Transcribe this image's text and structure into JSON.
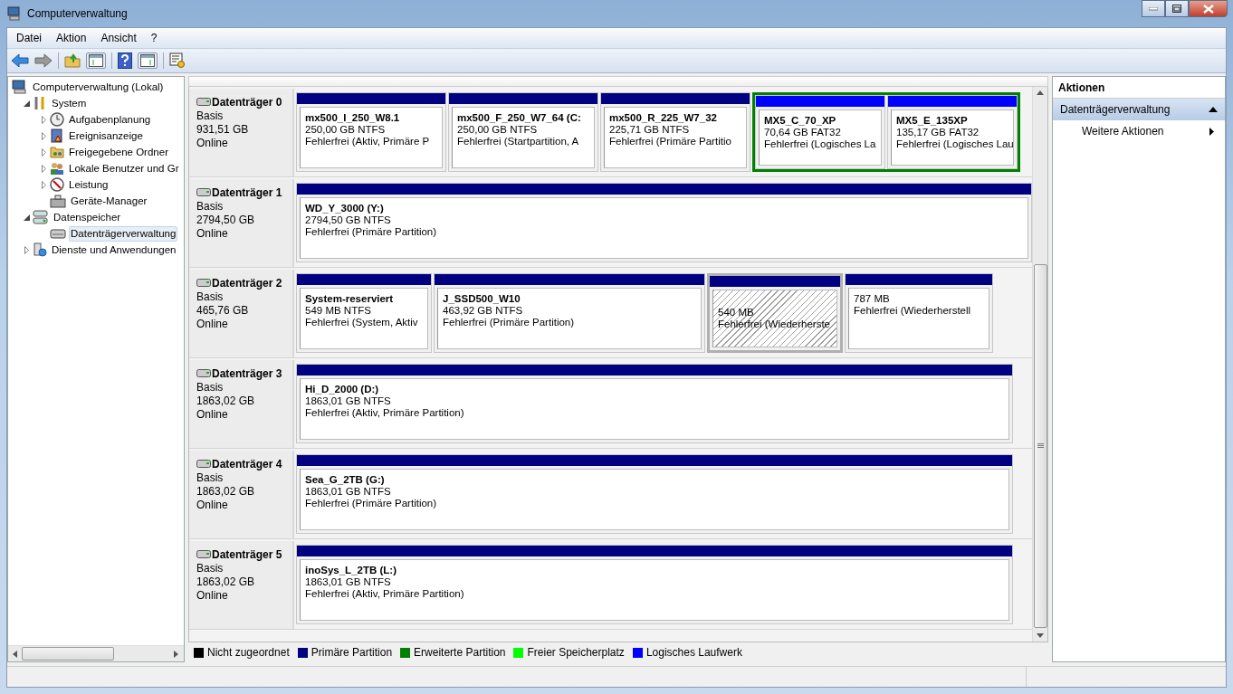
{
  "window": {
    "title": "Computerverwaltung"
  },
  "menu": [
    "Datei",
    "Aktion",
    "Ansicht",
    "?"
  ],
  "tree": [
    {
      "label": "Computerverwaltung (Lokal)",
      "kind": "root",
      "selected": false,
      "children": [
        {
          "label": "System",
          "kind": "branch",
          "expanded": true,
          "selected": false,
          "children": [
            {
              "label": "Aufgabenplanung",
              "kind": "branch",
              "expanded": false,
              "selected": false
            },
            {
              "label": "Ereignisanzeige",
              "kind": "branch",
              "expanded": false,
              "selected": false
            },
            {
              "label": "Freigegebene Ordner",
              "kind": "branch",
              "expanded": false,
              "selected": false
            },
            {
              "label": "Lokale Benutzer und Gr",
              "kind": "branch",
              "expanded": false,
              "selected": false
            },
            {
              "label": "Leistung",
              "kind": "branch",
              "expanded": false,
              "selected": false
            },
            {
              "label": "Geräte-Manager",
              "kind": "leaf",
              "selected": false
            }
          ]
        },
        {
          "label": "Datenspeicher",
          "kind": "branch",
          "expanded": true,
          "selected": false,
          "children": [
            {
              "label": "Datenträgerverwaltung",
              "kind": "leaf",
              "selected": true
            }
          ]
        },
        {
          "label": "Dienste und Anwendungen",
          "kind": "branch",
          "expanded": false,
          "selected": false
        }
      ]
    }
  ],
  "disks": [
    {
      "name": "Datenträger 0",
      "type": "Basis",
      "size": "931,51 GB",
      "state": "Online",
      "partitions": [
        {
          "kind": "primary",
          "name": "mx500_I_250_W8.1",
          "size": "250,00 GB NTFS",
          "status": "Fehlerfrei (Aktiv, Primäre P",
          "selected": false
        },
        {
          "kind": "primary",
          "name": "mx500_F_250_W7_64  (C:",
          "size": "250,00 GB NTFS",
          "status": "Fehlerfrei (Startpartition, A",
          "selected": false
        },
        {
          "kind": "primary",
          "name": "mx500_R_225_W7_32",
          "size": "225,71 GB NTFS",
          "status": "Fehlerfrei (Primäre Partitio",
          "selected": false
        },
        {
          "kind": "extended",
          "children": [
            {
              "kind": "logical",
              "name": "MX5_C_70_XP",
              "size": "70,64 GB FAT32",
              "status": "Fehlerfrei (Logisches La",
              "selected": false
            },
            {
              "kind": "logical",
              "name": "MX5_E_135XP",
              "size": "135,17 GB FAT32",
              "status": "Fehlerfrei (Logisches Lau",
              "selected": false
            }
          ]
        }
      ]
    },
    {
      "name": "Datenträger 1",
      "type": "Basis",
      "size": "2794,50 GB",
      "state": "Online",
      "partitions": [
        {
          "kind": "primary",
          "name": "WD_Y_3000  (Y:)",
          "size": "2794,50 GB NTFS",
          "status": "Fehlerfrei (Primäre Partition)",
          "selected": false
        }
      ]
    },
    {
      "name": "Datenträger 2",
      "type": "Basis",
      "size": "465,76 GB",
      "state": "Online",
      "partitions": [
        {
          "kind": "primary",
          "name": "System-reserviert",
          "size": "549 MB NTFS",
          "status": "Fehlerfrei (System, Aktiv",
          "selected": false
        },
        {
          "kind": "primary",
          "name": "J_SSD500_W10",
          "size": "463,92 GB NTFS",
          "status": "Fehlerfrei (Primäre Partition)",
          "selected": false
        },
        {
          "kind": "primary",
          "size": "540 MB",
          "status": "Fehlerfrei (Wiederherste",
          "selected": true
        },
        {
          "kind": "primary",
          "size": "787 MB",
          "status": "Fehlerfrei (Wiederherstell",
          "selected": false
        }
      ]
    },
    {
      "name": "Datenträger 3",
      "type": "Basis",
      "size": "1863,02 GB",
      "state": "Online",
      "partitions": [
        {
          "kind": "primary",
          "name": "Hi_D_2000  (D:)",
          "size": "1863,01 GB NTFS",
          "status": "Fehlerfrei (Aktiv, Primäre Partition)",
          "selected": false
        }
      ]
    },
    {
      "name": "Datenträger 4",
      "type": "Basis",
      "size": "1863,02 GB",
      "state": "Online",
      "partitions": [
        {
          "kind": "primary",
          "name": "Sea_G_2TB  (G:)",
          "size": "1863,01 GB NTFS",
          "status": "Fehlerfrei (Primäre Partition)",
          "selected": false
        }
      ]
    },
    {
      "name": "Datenträger 5",
      "type": "Basis",
      "size": "1863,02 GB",
      "state": "Online",
      "partitions": [
        {
          "kind": "primary",
          "name": "inoSys_L_2TB  (L:)",
          "size": "1863,01 GB NTFS",
          "status": "Fehlerfrei (Aktiv, Primäre Partition)",
          "selected": false
        }
      ]
    }
  ],
  "legend": [
    {
      "label": "Nicht zugeordnet",
      "color": "#000000"
    },
    {
      "label": "Primäre Partition",
      "color": "#000080"
    },
    {
      "label": "Erweiterte Partition",
      "color": "#008000"
    },
    {
      "label": "Freier Speicherplatz",
      "color": "#00ff00"
    },
    {
      "label": "Logisches Laufwerk",
      "color": "#0000ff"
    }
  ],
  "actions": {
    "title": "Aktionen",
    "sections": [
      {
        "label": "Datenträgerverwaltung",
        "expanded": true,
        "items": [
          "Weitere Aktionen"
        ]
      }
    ]
  }
}
